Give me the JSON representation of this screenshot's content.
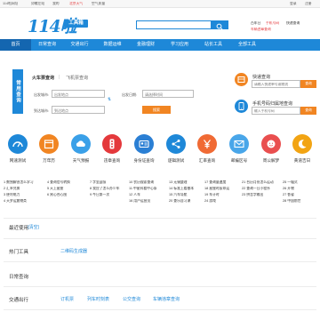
{
  "topbar": {
    "left": [
      "114啦网址",
      "卯螺左站",
      "我的",
      "北京天气",
      "空气质量"
    ],
    "right": [
      "登录",
      "注册"
    ]
  },
  "header": {
    "logo_text": "114啦",
    "logo_badge": "工具箱",
    "search_placeholder": "",
    "hot_links": [
      "百年日",
      "手机号码",
      "快递查询",
      "车辆违章查询"
    ]
  },
  "nav": {
    "items": [
      "首页",
      "日常查询",
      "交通出行",
      "数据运维",
      "金融理财",
      "学习应用",
      "站长工具",
      "全部工具"
    ]
  },
  "query": {
    "side_tab": "常用查询",
    "tabs": [
      "火车票查询",
      "飞机票查询"
    ],
    "from_label": "出发城市:",
    "from_placeholder": "出发地点",
    "date_label": "出发日期:",
    "date_placeholder": "请选择时间",
    "to_label": "到达城市:",
    "to_placeholder": "到达地点",
    "submit": "搜索"
  },
  "right_boxes": [
    {
      "title": "快递查询",
      "placeholder": "请输入快递单号或物流",
      "button": "查询"
    },
    {
      "title": "手机号码归属地查询",
      "placeholder": "输入手机号码",
      "button": "查询"
    }
  ],
  "grid": [
    {
      "label": "网速测试",
      "icon": "speedometer-icon",
      "color": "#1e88d8"
    },
    {
      "label": "万年历",
      "icon": "calendar-icon",
      "color": "#f18522"
    },
    {
      "label": "天气预报",
      "icon": "cloud-icon",
      "color": "#3aa0e8"
    },
    {
      "label": "违章查询",
      "icon": "traffic-light-icon",
      "color": "#e4393c"
    },
    {
      "label": "身份证查询",
      "icon": "id-card-icon",
      "color": "#2b7fd4"
    },
    {
      "label": "逻辑测试",
      "icon": "diagram-icon",
      "color": "#1e88d8"
    },
    {
      "label": "汇率查询",
      "icon": "yuan-icon",
      "color": "#f06a34"
    },
    {
      "label": "邮编区号",
      "icon": "mail-icon",
      "color": "#49a6e9"
    },
    {
      "label": "周公解梦",
      "icon": "face-icon",
      "color": "#e94f4f"
    },
    {
      "label": "黄道吉日",
      "icon": "moon-icon",
      "color": "#f2a413"
    }
  ],
  "link_rows": [
    [
      "1 数独解答怎么学习",
      "4 查询信号转换",
      "7 字里返吸",
      "10 农历搜索查询",
      "13 无锡整理",
      "17 查询量速度",
      "21 台历月份怎么运动",
      "25 一幅式"
    ],
    [
      "2 汇率兑换",
      "5 天上星座",
      "8 我应了怎么办少年",
      "11 中星科看中心条",
      "14 标准上看基本",
      "18 星座时辰命运",
      "22 查询一日小程序",
      "26 开物"
    ],
    [
      "3 便利电力",
      "6 黑心合心图",
      "9 今日第一次",
      "12 人车",
      "15 汽车导航",
      "19 车计时",
      "23 拼音字输出",
      "27 各省"
    ],
    [
      "4 天罗运复物类",
      "",
      "",
      "16 用户运营员",
      "20 查乐自习课",
      "24 游戏",
      "",
      "28 中国前世"
    ]
  ],
  "sections": [
    {
      "title": "最近使用",
      "suffix": "(清空)",
      "links": []
    },
    {
      "title": "热门工具",
      "suffix": "",
      "links": [
        "二维码生成器"
      ]
    },
    {
      "title": "日常查询",
      "suffix": "",
      "links": []
    },
    {
      "title": "交通出行",
      "suffix": "",
      "links": [
        "订机票",
        "列车时刻表",
        "公交查询",
        "车辆违章查询"
      ]
    }
  ],
  "colors": {
    "brand": "#1e88d8",
    "accent": "#f18522",
    "red": "#e4393c"
  }
}
